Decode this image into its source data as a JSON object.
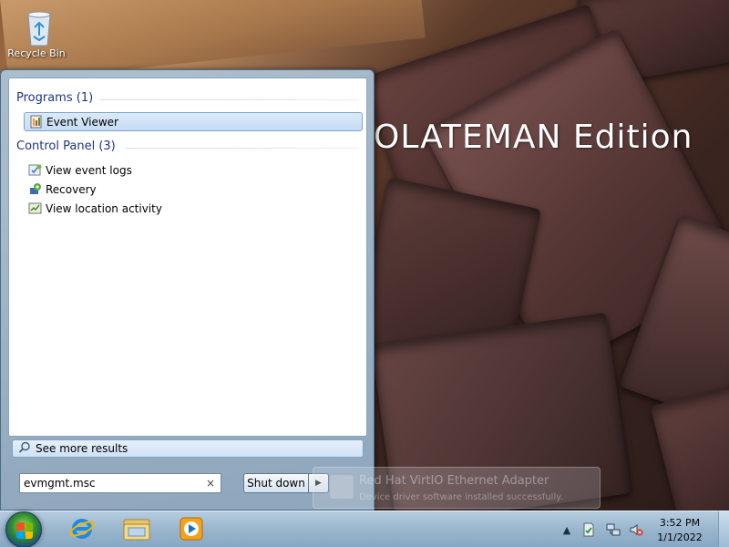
{
  "desktop": {
    "recycle_bin_label": "Recycle Bin",
    "wallpaper_text": "OLATEMAN Edition"
  },
  "start_menu": {
    "groups": [
      {
        "title": "Programs (1)",
        "items": [
          {
            "label": "Event Viewer",
            "icon": "event-viewer-icon",
            "selected": true
          }
        ]
      },
      {
        "title": "Control Panel (3)",
        "items": [
          {
            "label": "View event logs",
            "icon": "event-logs-icon"
          },
          {
            "label": "Recovery",
            "icon": "recovery-icon"
          },
          {
            "label": "View location activity",
            "icon": "location-activity-icon"
          }
        ]
      }
    ],
    "see_more_label": "See more results",
    "search_value": "evmgmt.msc",
    "clear_symbol": "×",
    "shutdown_label": "Shut down",
    "shutdown_arrow": "▶"
  },
  "notification": {
    "title": "Red Hat VirtIO Ethernet Adapter",
    "body": "Device driver software installed successfully."
  },
  "taskbar": {
    "pinned": [
      {
        "name": "internet-explorer-icon"
      },
      {
        "name": "windows-explorer-icon"
      },
      {
        "name": "media-player-icon"
      }
    ],
    "tray_chevron": "▲",
    "clock_time": "3:52 PM",
    "clock_date": "1/1/2022"
  },
  "colors": {
    "group_title": "#1e3287",
    "selection_border": "#7da2ce",
    "taskbar": "#a0bed7"
  }
}
